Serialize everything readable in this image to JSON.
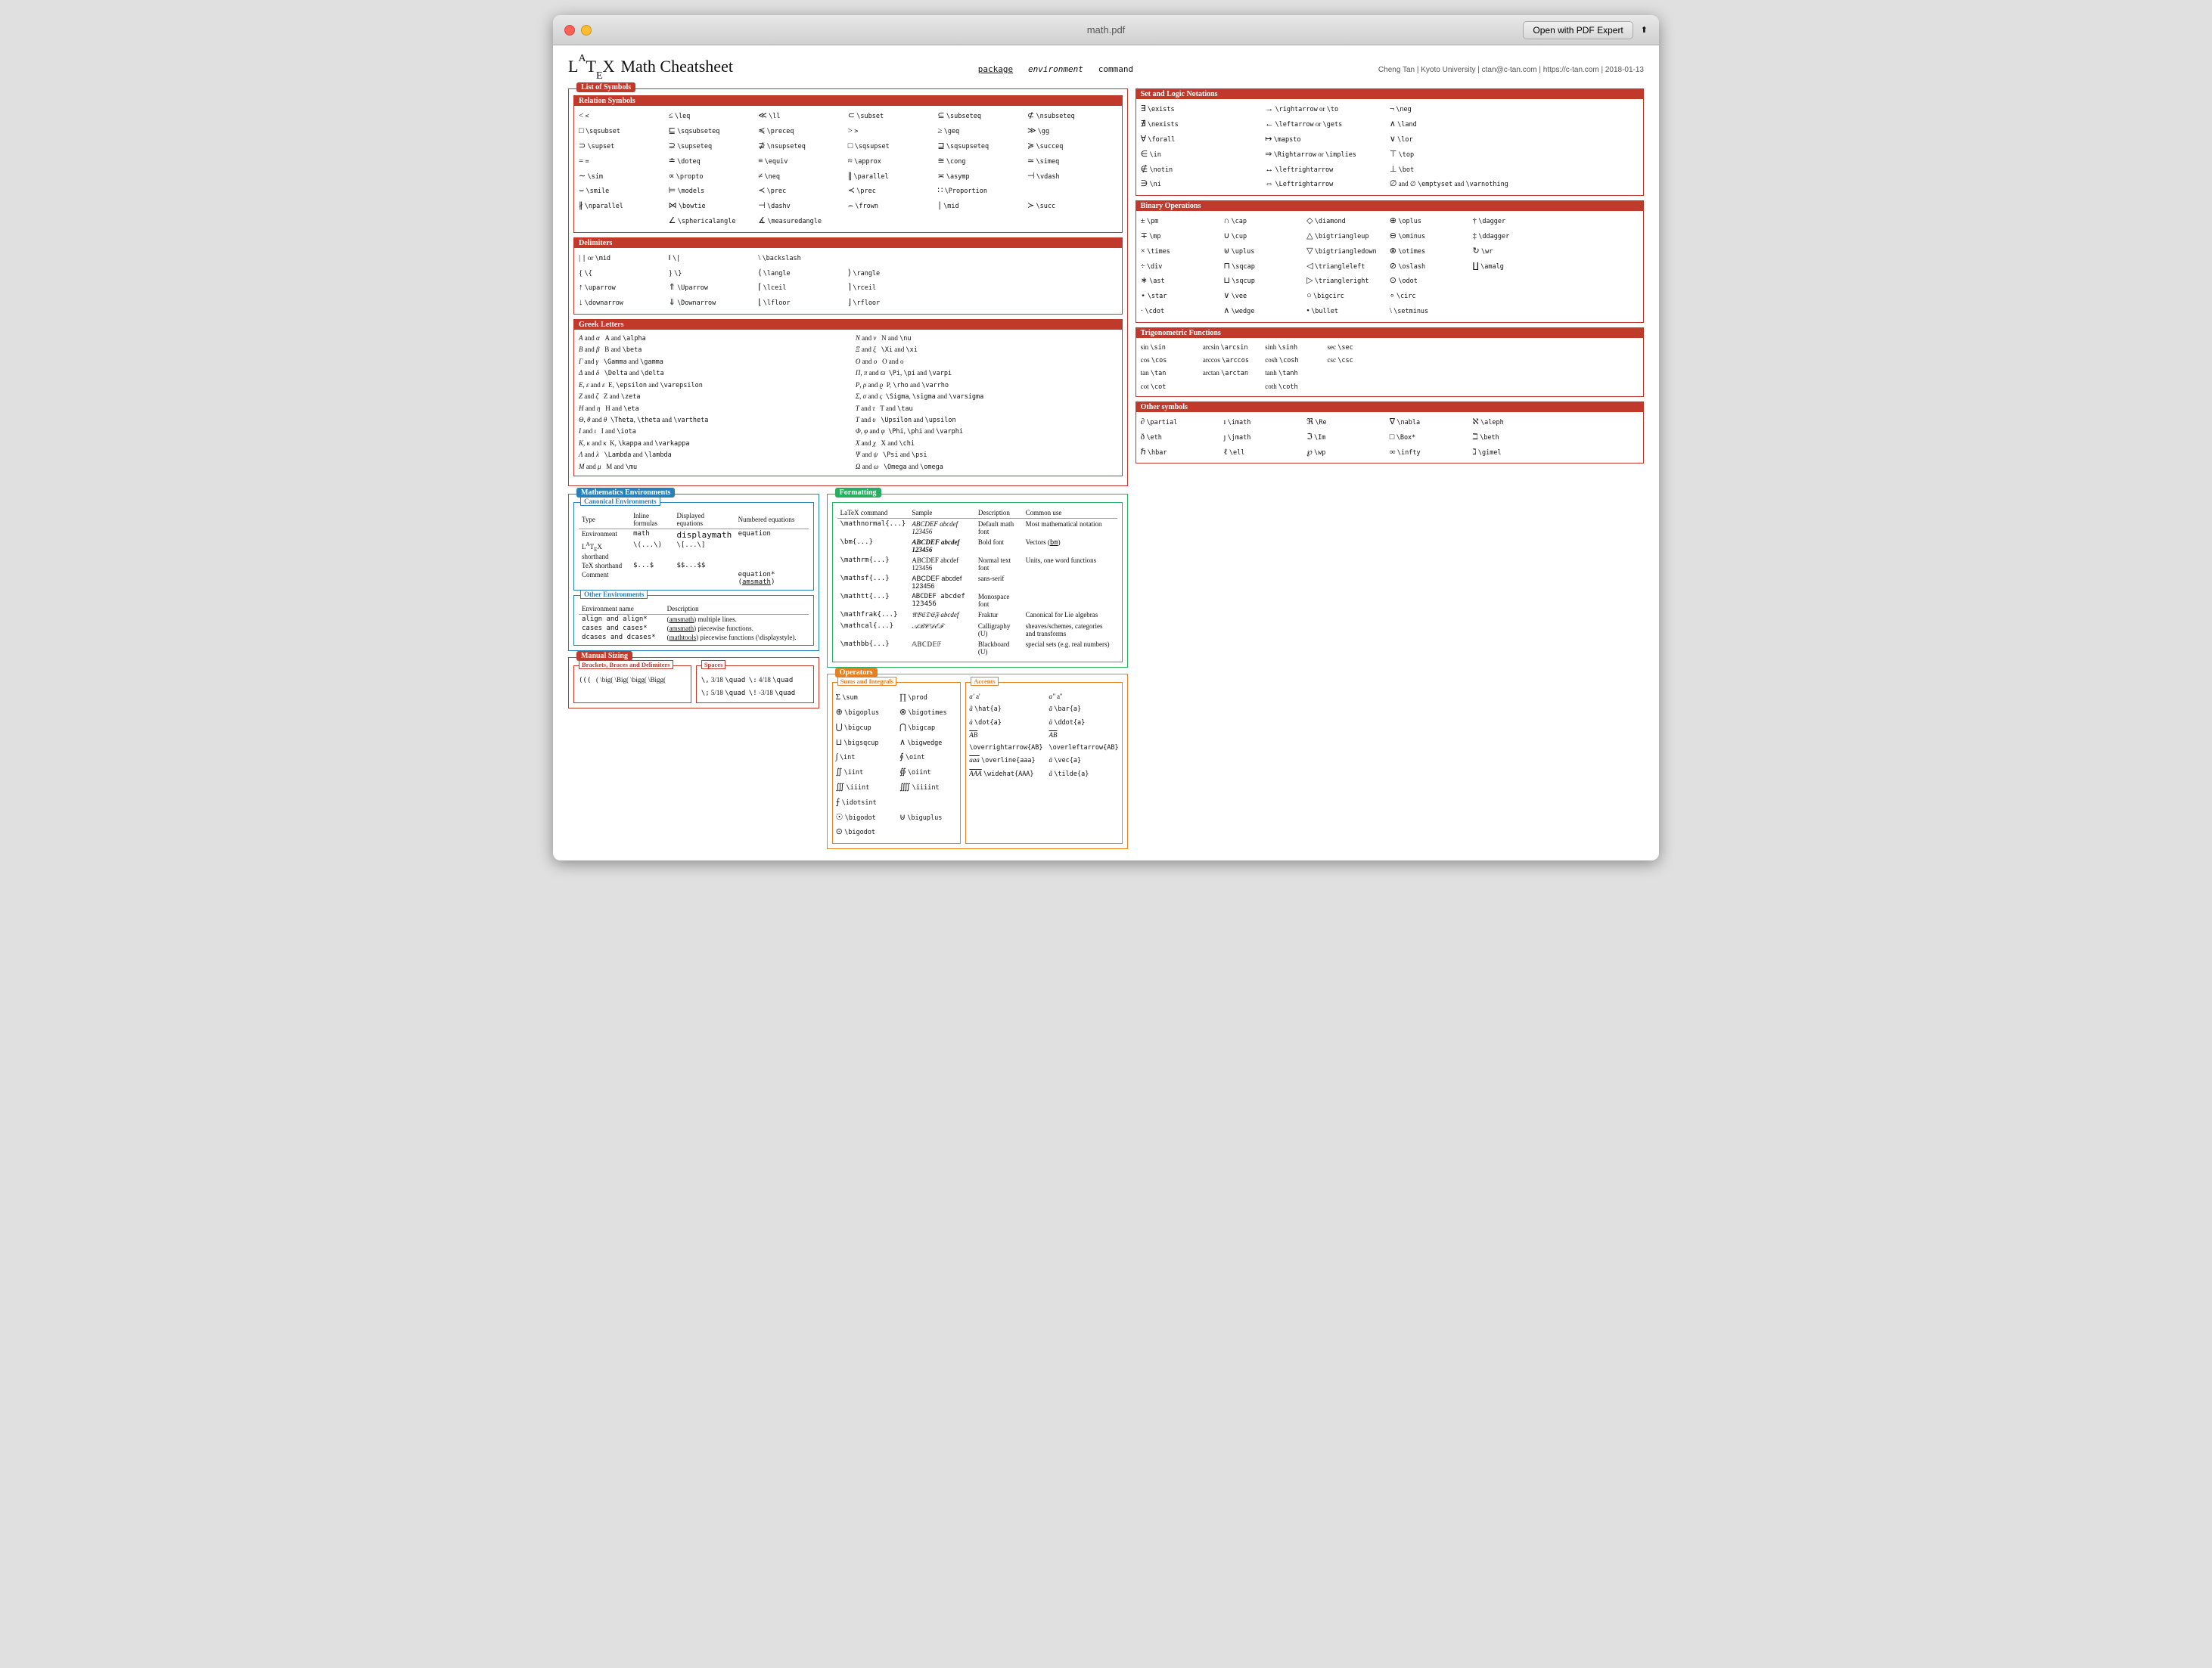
{
  "window": {
    "title": "math.pdf",
    "open_btn": "Open with PDF Expert"
  },
  "doc": {
    "title": "LaTeX Math Cheatsheet",
    "meta": "Cheng Tan | Kyoto University | ctan@c-tan.com | https://c-tan.com | 2018-01-13",
    "header": {
      "package": "package",
      "environment": "environment",
      "command": "command"
    }
  }
}
